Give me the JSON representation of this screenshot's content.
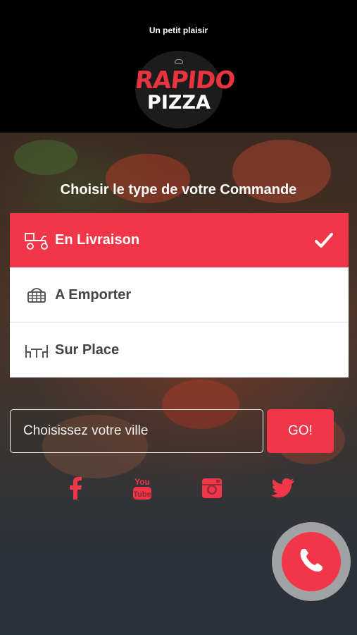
{
  "header": {
    "tagline": "Un petit plaisir",
    "logo_top": "RAPIDO",
    "logo_bottom": "PIZZA"
  },
  "order_type": {
    "prompt": "Choisir le type de votre Commande",
    "options": [
      {
        "label": "En Livraison",
        "icon": "delivery-scooter-icon",
        "selected": true
      },
      {
        "label": "A Emporter",
        "icon": "basket-icon",
        "selected": false
      },
      {
        "label": "Sur Place",
        "icon": "table-chairs-icon",
        "selected": false
      }
    ]
  },
  "city": {
    "placeholder": "Choisissez votre ville",
    "go_label": "GO!"
  },
  "social": [
    "facebook-icon",
    "youtube-icon",
    "instagram-icon",
    "twitter-icon"
  ],
  "colors": {
    "accent": "#f2364a",
    "header_bg": "#000000"
  }
}
